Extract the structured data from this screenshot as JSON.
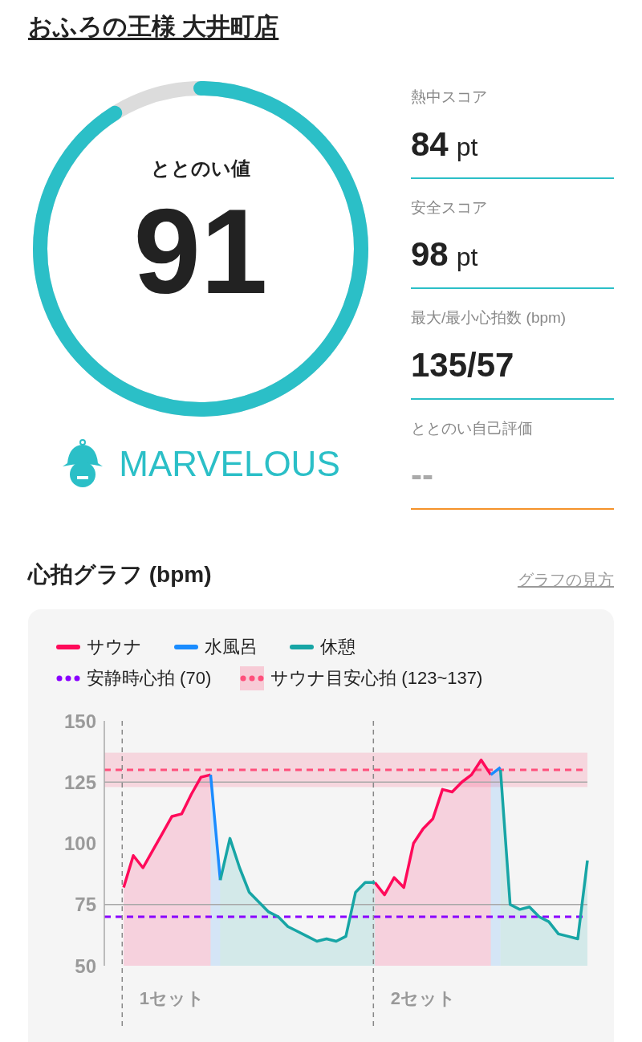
{
  "title": "おふろの王様 大井町店",
  "score": {
    "label": "ととのい値",
    "value": "91",
    "level": 0.91,
    "rating": "MARVELOUS"
  },
  "stats": [
    {
      "label": "熱中スコア",
      "value": "84",
      "unit": "pt",
      "color": "#2bbfc7",
      "rated": true
    },
    {
      "label": "安全スコア",
      "value": "98",
      "unit": "pt",
      "color": "#2bbfc7",
      "rated": true
    },
    {
      "label": "最大/最小心拍数 (bpm)",
      "value": "135/57",
      "color": "#2bbfc7",
      "rated": true
    },
    {
      "label": "ととのい自己評価",
      "value": "--",
      "color": "#f5922a",
      "rated": false
    }
  ],
  "chart_section": {
    "title": "心拍グラフ (bpm)",
    "help_link": "グラフの見方",
    "chart_data": {
      "type": "area",
      "ylim": [
        50,
        150
      ],
      "yticks": [
        50,
        75,
        100,
        125,
        150
      ],
      "categories": [
        null,
        null,
        null,
        null,
        null,
        null,
        null,
        "1セット",
        null,
        null,
        null,
        null,
        null,
        null,
        null,
        null,
        null,
        null,
        null,
        null,
        null,
        null,
        null,
        null,
        null,
        null,
        null,
        null,
        null,
        null,
        null,
        null,
        null,
        "2セット",
        null,
        null,
        null,
        null,
        null,
        null,
        null,
        null,
        null,
        null,
        null,
        null,
        null,
        null,
        null,
        null,
        null
      ],
      "series": [
        {
          "name": "サウナ",
          "color": "#ff0a5a",
          "values": [
            null,
            null,
            82,
            95,
            90,
            97,
            104,
            111,
            112,
            120,
            127,
            128,
            null,
            null,
            null,
            null,
            null,
            null,
            null,
            null,
            null,
            null,
            null,
            null,
            null,
            null,
            null,
            null,
            84,
            79,
            86,
            82,
            100,
            106,
            110,
            122,
            121,
            125,
            128,
            134,
            128,
            null,
            null,
            null,
            null,
            null,
            null,
            null,
            null,
            null,
            null
          ]
        },
        {
          "name": "水風呂",
          "color": "#1a8cff",
          "values": [
            null,
            null,
            null,
            null,
            null,
            null,
            null,
            null,
            null,
            null,
            null,
            128,
            85,
            null,
            null,
            null,
            null,
            null,
            null,
            null,
            null,
            null,
            null,
            null,
            null,
            null,
            null,
            null,
            null,
            null,
            null,
            null,
            null,
            null,
            null,
            null,
            null,
            null,
            null,
            null,
            128,
            131,
            null,
            null,
            null,
            null,
            null,
            null,
            null,
            null,
            null
          ]
        },
        {
          "name": "休憩",
          "color": "#17a5a5",
          "values": [
            null,
            null,
            null,
            null,
            null,
            null,
            null,
            null,
            null,
            null,
            null,
            null,
            85,
            102,
            90,
            80,
            76,
            72,
            70,
            66,
            64,
            62,
            60,
            61,
            60,
            62,
            80,
            84,
            84,
            null,
            null,
            null,
            null,
            null,
            null,
            null,
            null,
            null,
            null,
            null,
            null,
            130,
            75,
            73,
            74,
            70,
            68,
            63,
            62,
            61,
            93
          ]
        }
      ],
      "ref_lines": [
        {
          "axis": "y",
          "value": 125,
          "color": "#a8a8a8"
        },
        {
          "axis": "y",
          "value": 75,
          "color": "#a8a8a8"
        },
        {
          "axis": "y",
          "value": 70,
          "label": "安静時心拍 (70)",
          "color": "#8a00ff"
        },
        {
          "axis": "y",
          "value": 130,
          "color": "#ff4f7b"
        }
      ],
      "bands": [
        {
          "axis": "y",
          "from": 123,
          "to": 137,
          "label": "サウナ目安心拍 (123~137)",
          "color": "#ff4f7b"
        }
      ]
    }
  }
}
